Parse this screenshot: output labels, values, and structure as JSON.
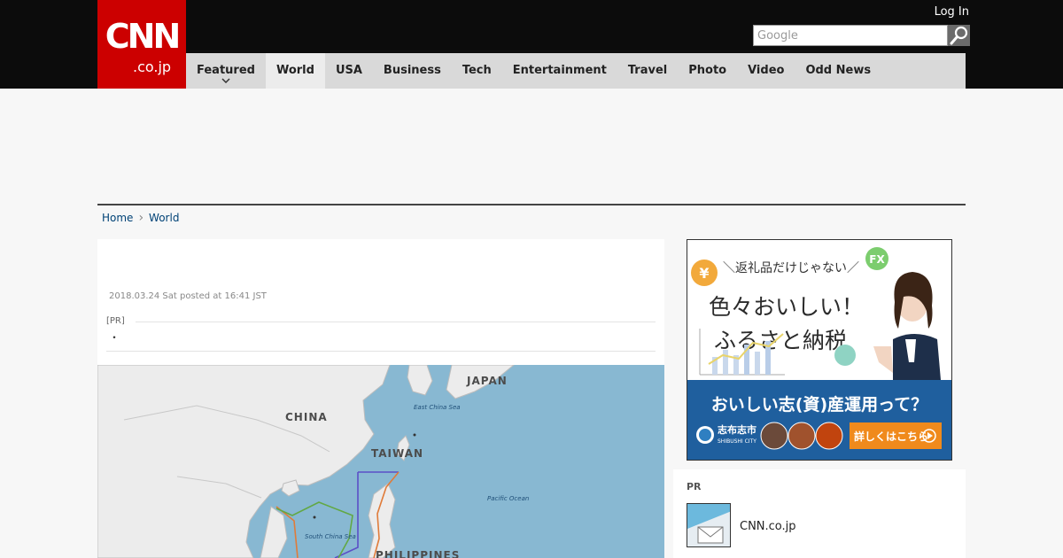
{
  "logo": {
    "main": "CNN",
    "sub": ".co.jp"
  },
  "header": {
    "login_label": "Log In",
    "search_placeholder": "Google"
  },
  "nav": {
    "items": [
      {
        "label": "Featured"
      },
      {
        "label": "World"
      },
      {
        "label": "USA"
      },
      {
        "label": "Business"
      },
      {
        "label": "Tech"
      },
      {
        "label": "Entertainment"
      },
      {
        "label": "Travel"
      },
      {
        "label": "Photo"
      },
      {
        "label": "Video"
      },
      {
        "label": "Odd News"
      }
    ],
    "active_index": 1
  },
  "breadcrumb": {
    "home": "Home",
    "current": "World"
  },
  "article": {
    "posted": "2018.03.24 Sat posted at 16:41 JST",
    "pr_label": "[PR]",
    "pr_item": "・"
  },
  "map": {
    "labels": {
      "japan": "JAPAN",
      "east_china_sea": "East China Sea",
      "china": "CHINA",
      "taiwan": "TAIWAN",
      "pacific_ocean": "Pacific Ocean",
      "south_china_sea": "South China Sea",
      "philippines": "PHILIPPINES"
    }
  },
  "ad": {
    "tagline": "＼返礼品だけじゃない／",
    "headline_1": "色々おいしい！",
    "headline_2": "ふるさと納税",
    "bottom_text": "おいしい志(資)産運用って？",
    "city_name": "志布志市",
    "city_romaji": "SHIBUSHI CITY",
    "cta": "詳しくはこちら",
    "badge_yen": "¥",
    "badge_fx": "FX"
  },
  "pr_box": {
    "title": "PR",
    "link": "CNN.co.jp"
  },
  "colors": {
    "brand_red": "#cc0000",
    "nav_bg": "#d9d9d9",
    "link_blue": "#004276",
    "ad_blue": "#1f5f9e",
    "ad_cta_orange": "#f08a1c"
  }
}
